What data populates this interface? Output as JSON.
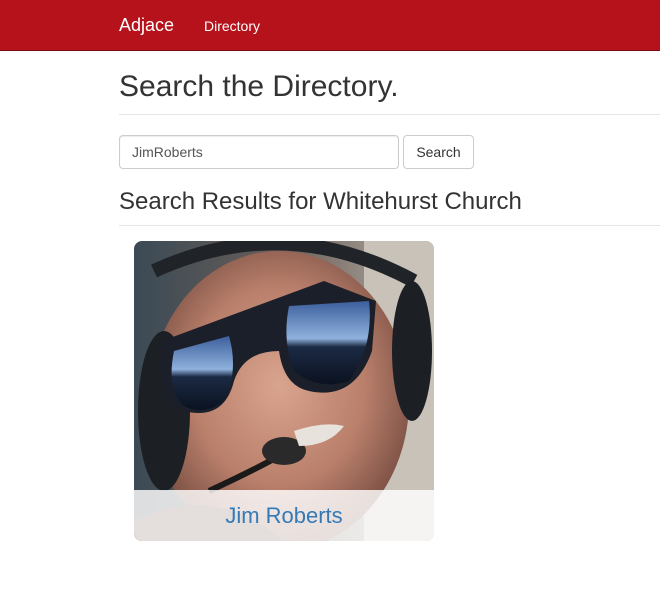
{
  "navbar": {
    "brand": "Adjace",
    "links": [
      {
        "label": "Directory"
      }
    ],
    "background_color": "#b5121b"
  },
  "main": {
    "title": "Search the Directory.",
    "search": {
      "value": "JimRoberts",
      "button_label": "Search"
    },
    "results_heading": "Search Results for Whitehurst Church",
    "results": [
      {
        "name": "Jim Roberts",
        "photo": "profile-photo"
      }
    ],
    "link_color": "#337ab7"
  }
}
